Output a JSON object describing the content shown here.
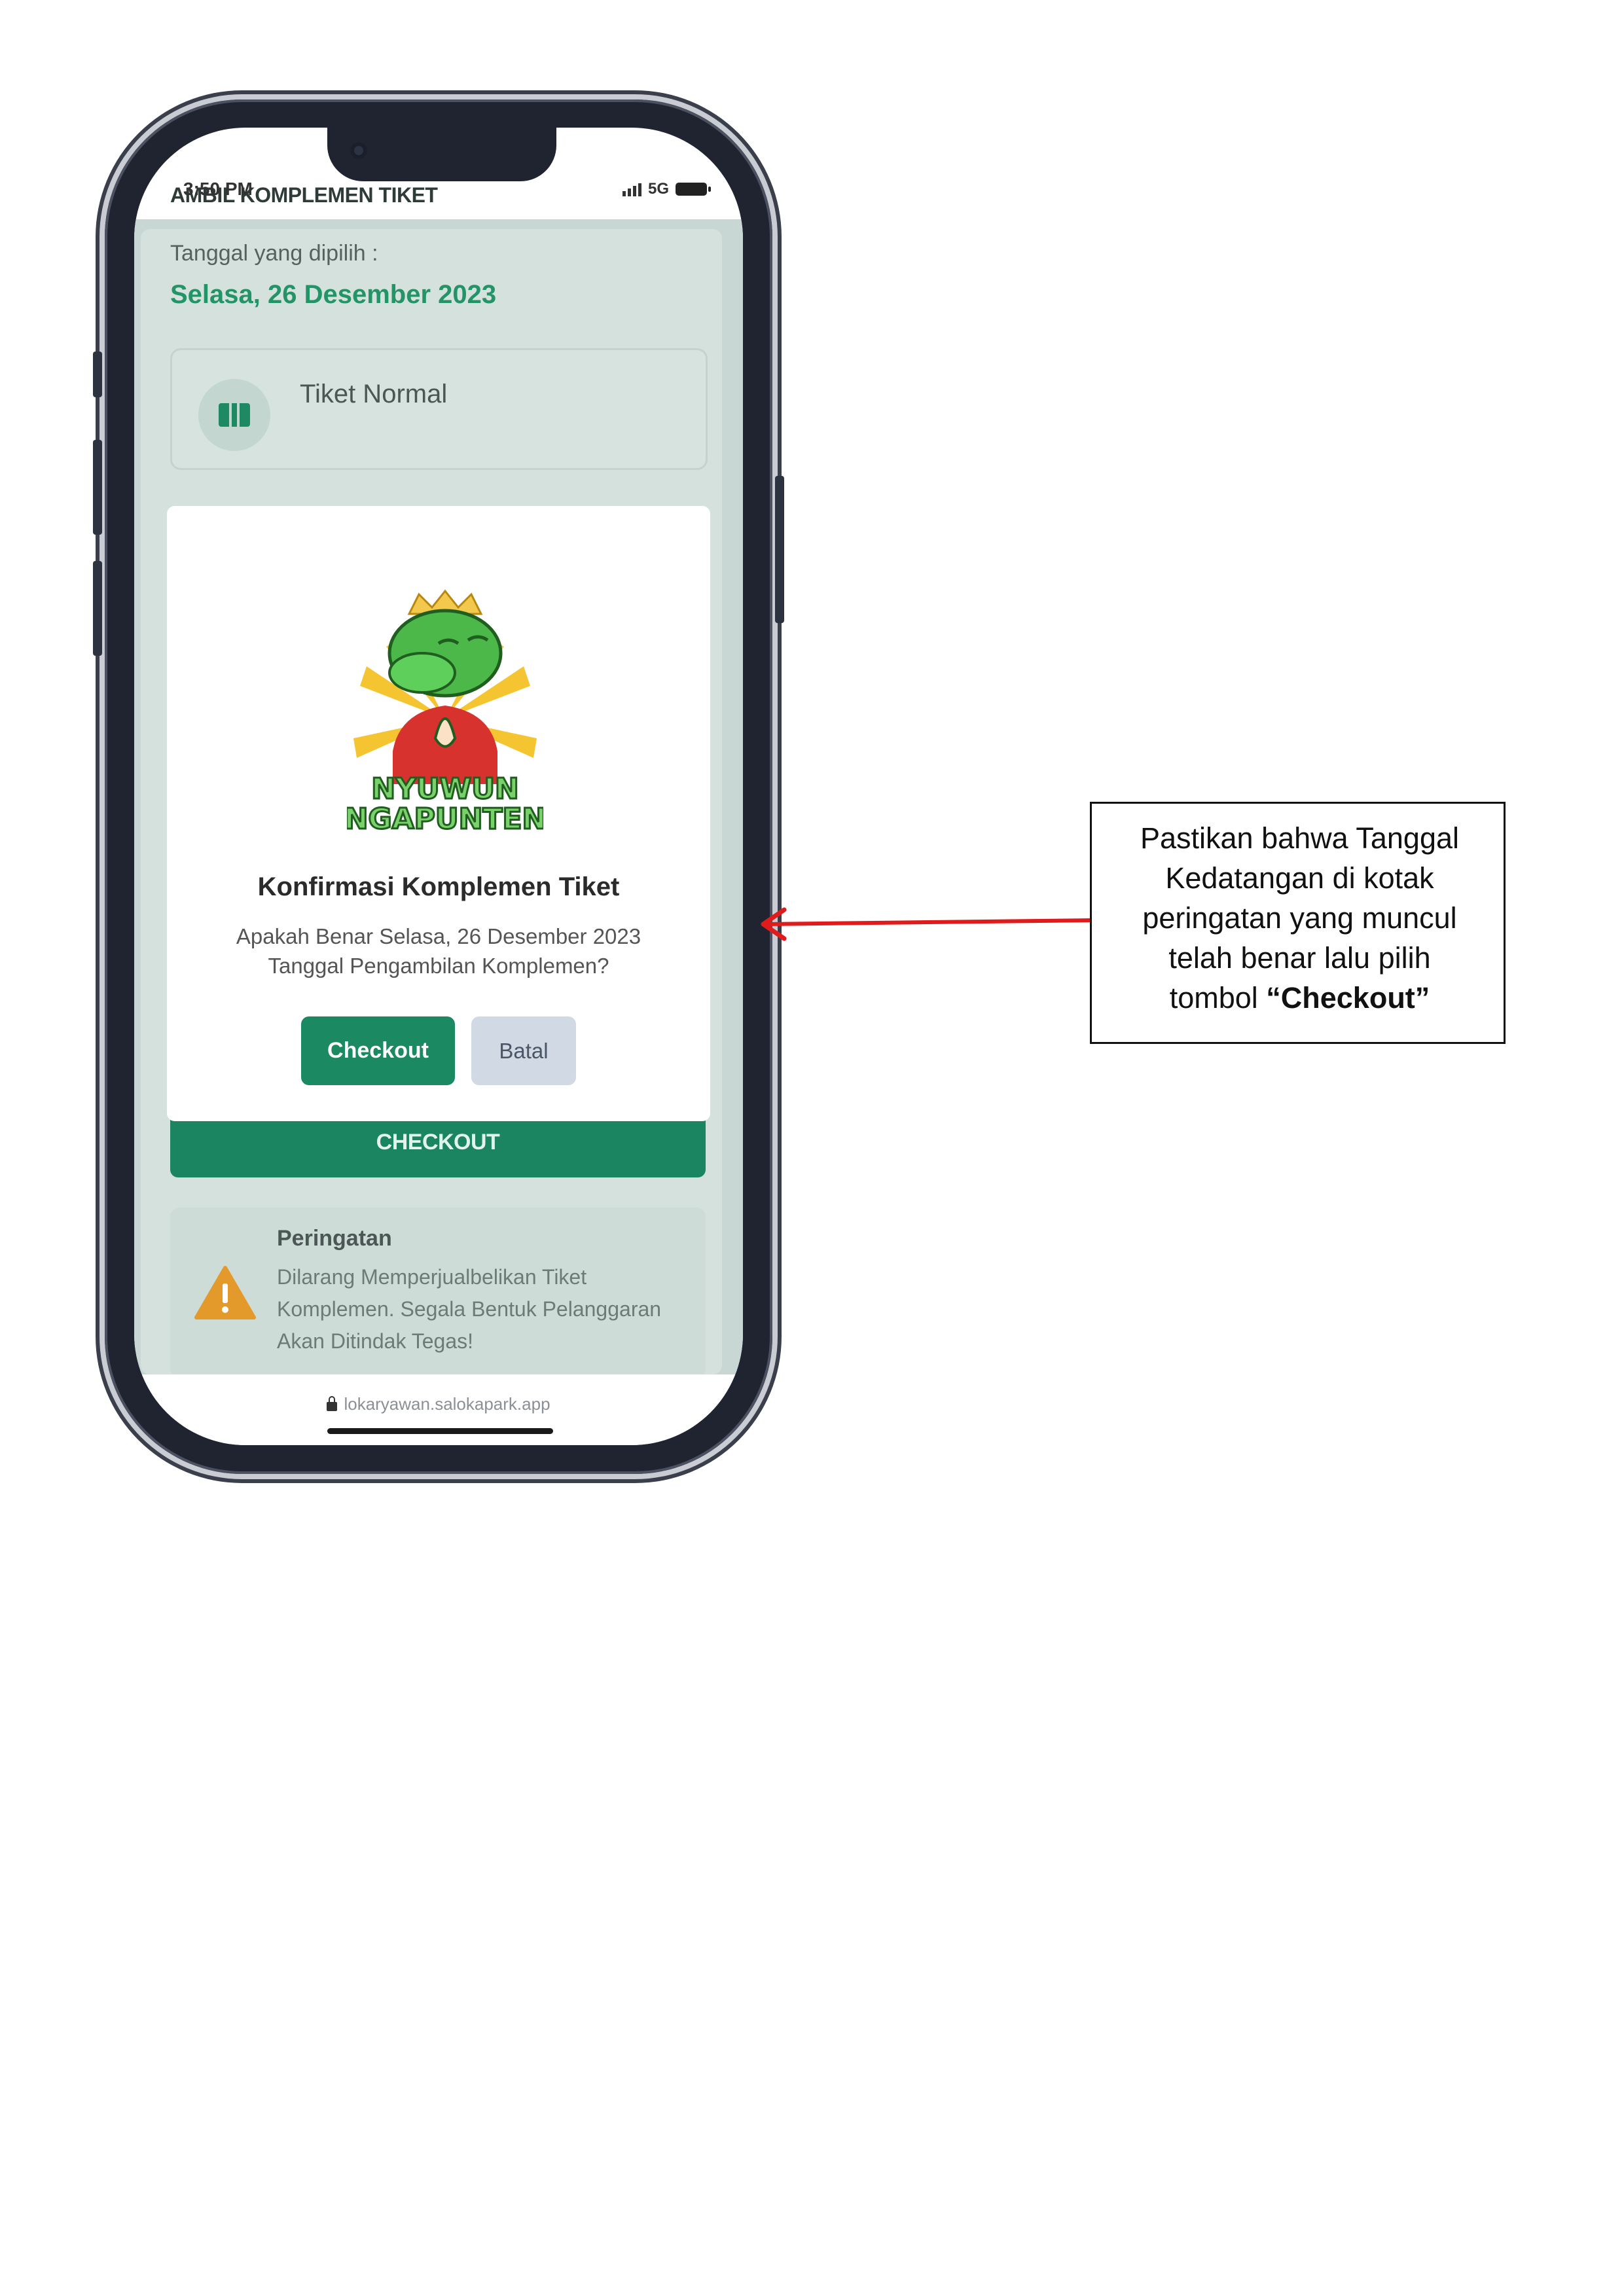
{
  "status_bar": {
    "time": "3:50 PM",
    "network": "5G"
  },
  "page": {
    "title": "AMBIL KOMPLEMEN TIKET",
    "date_label": "Tanggal yang dipilih :",
    "date_value": "Selasa, 26 Desember 2023",
    "ticket_name": "Tiket Normal",
    "checkout_button": "CHECKOUT"
  },
  "warning": {
    "title": "Peringatan",
    "text": "Dilarang Memperjualbelikan Tiket Komplemen. Segala Bentuk Pelanggaran Akan Ditindak Tegas!"
  },
  "browser": {
    "url": "lokaryawan.salokapark.app"
  },
  "modal": {
    "mascot_caption_line1": "NYUWUN",
    "mascot_caption_line2": "NGAPUNTEN",
    "title": "Konfirmasi Komplemen Tiket",
    "line1": "Apakah Benar Selasa, 26 Desember 2023",
    "line2": "Tanggal Pengambilan Komplemen?",
    "confirm_button": "Checkout",
    "cancel_button": "Batal"
  },
  "annotation": {
    "text_line1": "Pastikan bahwa Tanggal",
    "text_line2": "Kedatangan di kotak",
    "text_line3": "peringatan yang muncul",
    "text_line4": "telah benar lalu pilih",
    "text_line5_prefix": "tombol ",
    "text_line5_bold": "“Checkout”"
  },
  "colors": {
    "primary_green": "#1b8a63",
    "date_green": "#239468",
    "background_mint": "#c8d7d3",
    "warning_orange": "#e49a2b",
    "arrow_red": "#e01b1b"
  }
}
